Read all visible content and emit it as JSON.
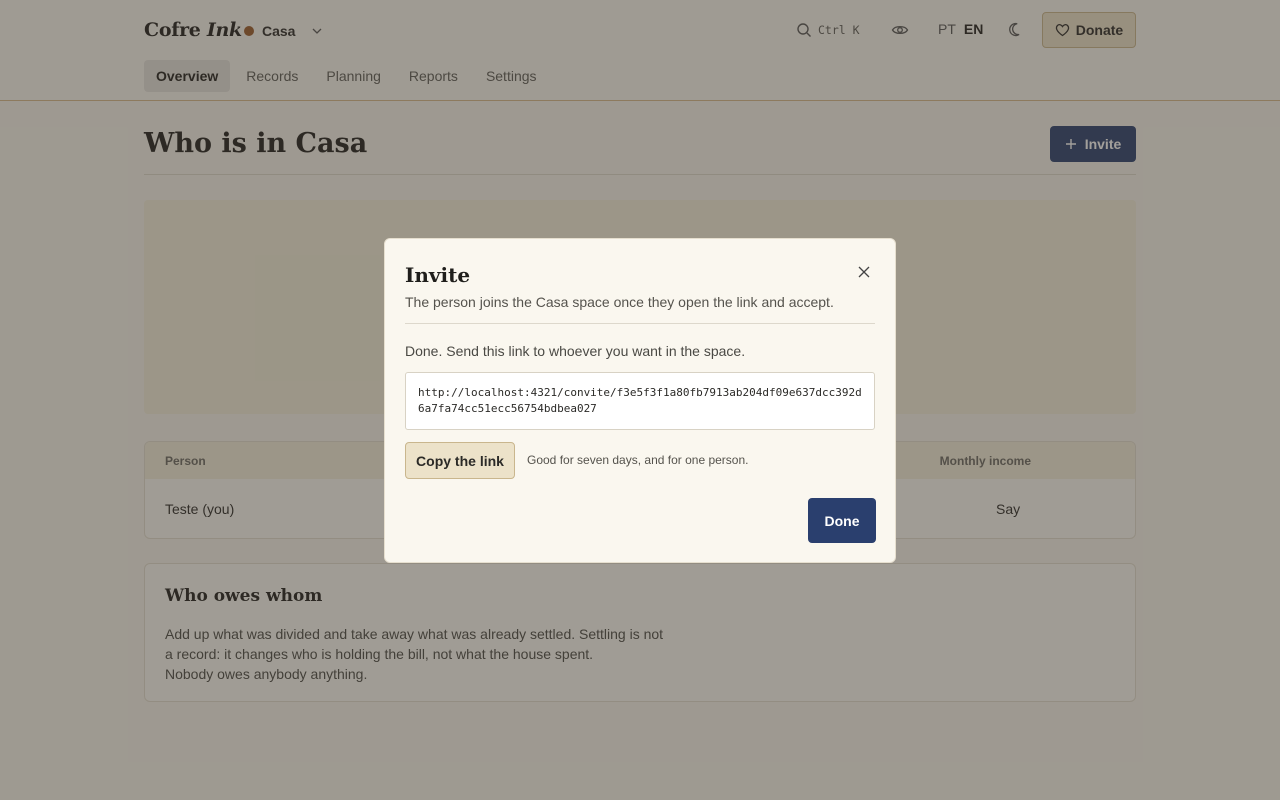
{
  "header": {
    "brand_main": "Cofre",
    "brand_italic": "Ink",
    "space_name": "Casa",
    "space_dot_color": "#9a5a2a",
    "search_shortcut": "Ctrl K",
    "lang_pt": "PT",
    "lang_en": "EN",
    "donate_label": "Donate",
    "icons": [
      "search-icon",
      "eye-icon",
      "moon-icon",
      "heart-icon",
      "chevron-down-icon"
    ]
  },
  "nav": {
    "tabs": [
      {
        "label": "Overview",
        "active": true
      },
      {
        "label": "Records",
        "active": false
      },
      {
        "label": "Planning",
        "active": false
      },
      {
        "label": "Reports",
        "active": false
      },
      {
        "label": "Settings",
        "active": false
      }
    ]
  },
  "main": {
    "title": "Who is in Casa",
    "invite_label": "Invite",
    "table": {
      "headers": {
        "person": "Person",
        "income": "Monthly income"
      },
      "rows": [
        {
          "person": "Teste (you)",
          "income": "Say"
        }
      ]
    },
    "owes": {
      "title": "Who owes whom",
      "line1": "Add up what was divided and take away what was already settled. Settling is not",
      "line2": "a record: it changes who is holding the bill, not what the house spent.",
      "line3": "Nobody owes anybody anything."
    }
  },
  "modal": {
    "title": "Invite",
    "subtitle": "The person joins the Casa space once they open the link and accept.",
    "done_text": "Done. Send this link to whoever you want in the space.",
    "link": "http://localhost:4321/convite/f3e5f3f1a80fb7913ab204df09e637dcc392d6a7fa74cc51ecc56754bdbea027",
    "copy_label": "Copy the link",
    "valid_note": "Good for seven days, and for one person.",
    "done_label": "Done"
  },
  "colors": {
    "accent": "#2a3f6e",
    "donate_bg": "#ece2c9",
    "background": "#f7f4ec"
  }
}
